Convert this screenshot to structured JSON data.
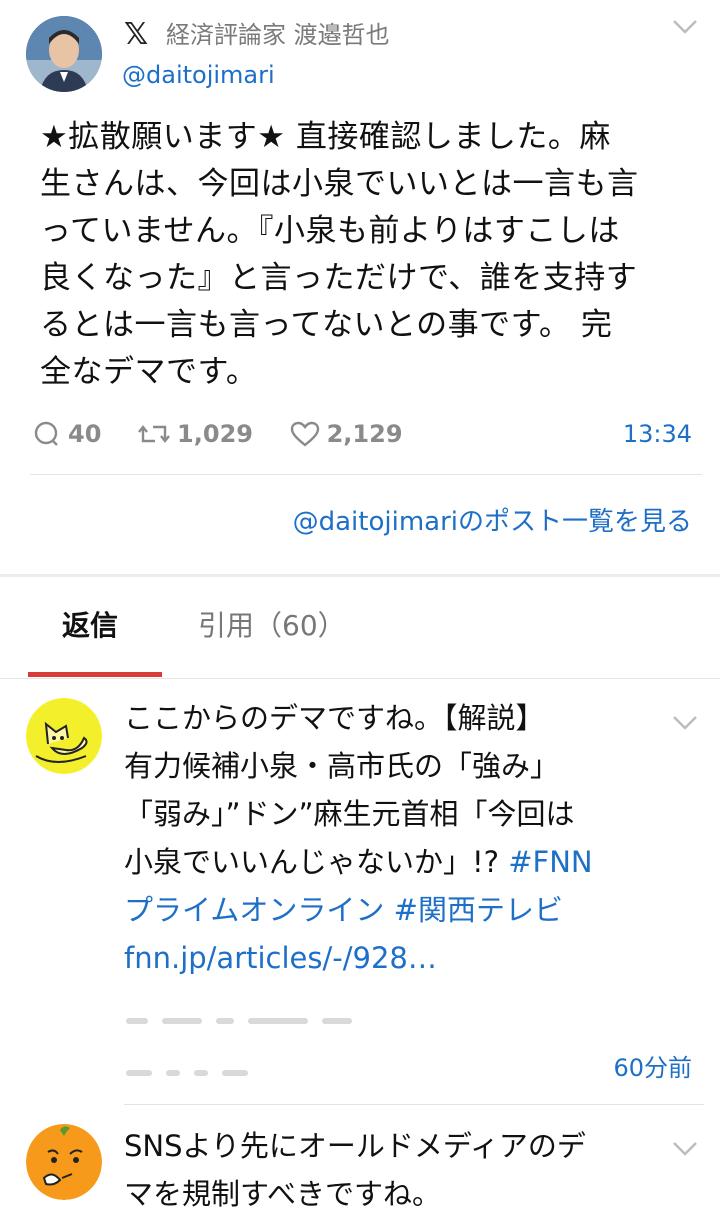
{
  "post": {
    "x_logo": "𝕏",
    "author_name": "経済評論家 渡邉哲也",
    "author_handle": "@daitojimari",
    "text_lines": [
      "★拡散願います★ 直接確認しました。麻",
      "生さんは、今回は小泉でいいとは一言も言",
      "っていません。『小泉も前よりはすこしは",
      "良くなった』と言っただけで、誰を支持す",
      "るとは一言も言ってないとの事です。 完",
      "全なデマです。"
    ],
    "reply_count": "40",
    "repost_count": "1,029",
    "like_count": "2,129",
    "time": "13:34",
    "see_posts_link": "@daitojimariのポスト一覧を見る"
  },
  "tabs": {
    "replies": "返信",
    "quotes": "引用（60）"
  },
  "replies": [
    {
      "text_line1": "ここからのデマですね。【解説】",
      "text_line2": "有力候補小泉・高市氏の「強み」",
      "text_line3": "「弱み」”ドン”麻生元首相「今回は",
      "text_line4_plain": "小泉でいいんじゃないか」!? ",
      "hashtag1": "#FNN",
      "hashtag1_cont": "プライムオンライン",
      "hashtag2": "#関西テレビ",
      "url": "fnn.jp/articles/-/928…",
      "time": "60分前"
    },
    {
      "text_line1": "SNSより先にオールドメディアのデ",
      "text_line2": "マを規制すべきですね。"
    }
  ],
  "icons": [
    "x-logo-icon",
    "chevron-down-icon",
    "reply-icon",
    "repost-icon",
    "like-icon"
  ],
  "colors": {
    "link": "#1d6fc7",
    "tab_accent": "#d93a3a",
    "muted": "#8a8a8a"
  }
}
